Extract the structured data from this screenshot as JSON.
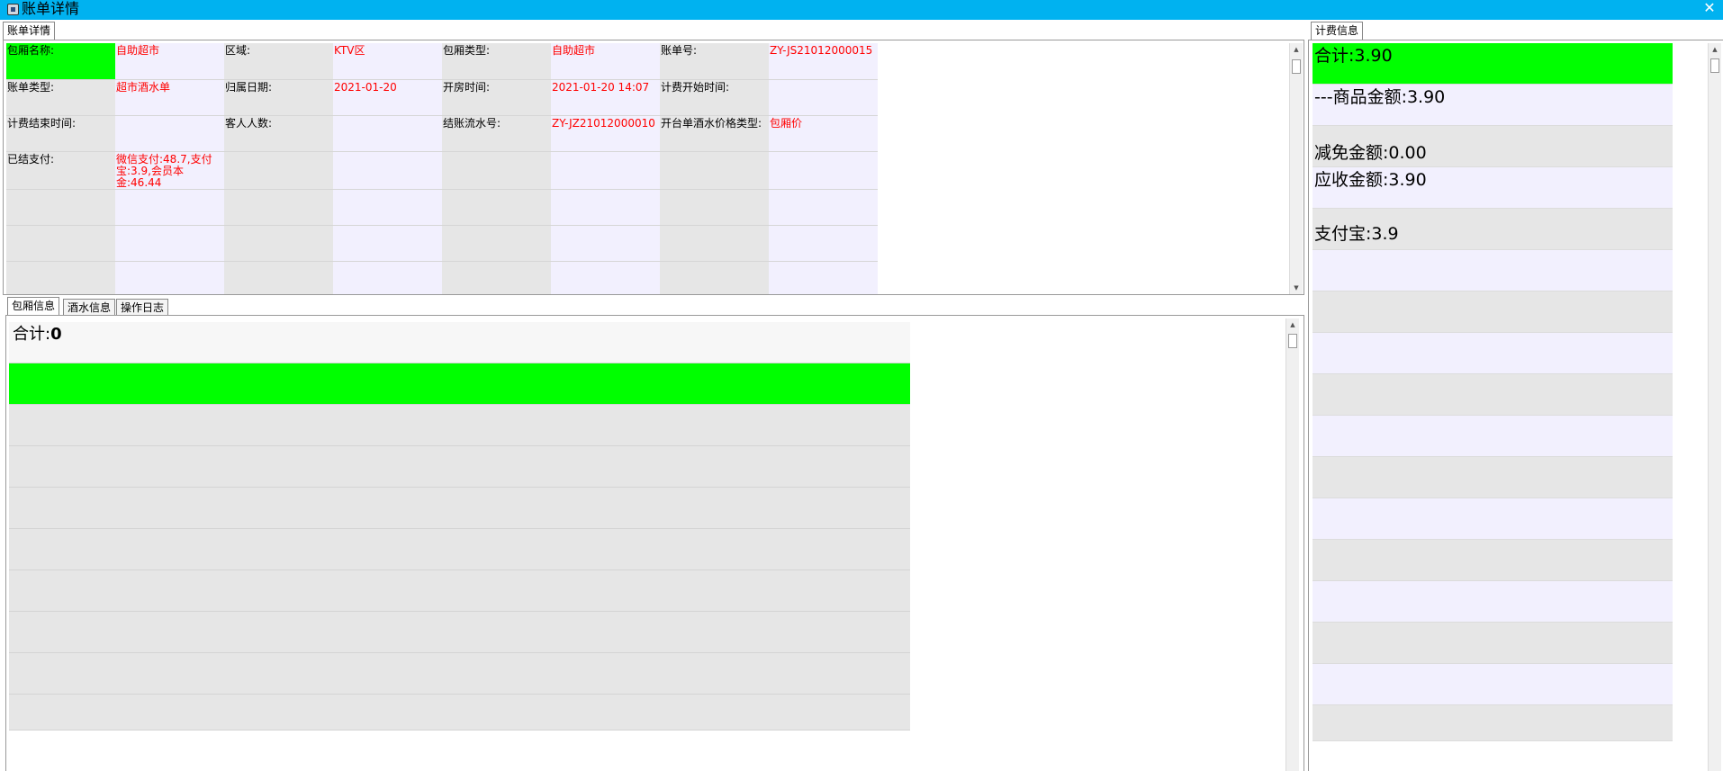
{
  "window": {
    "title": "账单详情",
    "close_glyph": "✕"
  },
  "colors": {
    "titlebar": "#00b2f0",
    "highlight": "#00ff00",
    "value_text": "#ff0000",
    "label_bg": "#e6e6e6",
    "value_bg": "#f2f0fe"
  },
  "detail_tab": {
    "label": "账单详情"
  },
  "bill": {
    "fields": [
      {
        "label": "包厢名称:",
        "value": "自助超市"
      },
      {
        "label": "区域:",
        "value": "KTV区"
      },
      {
        "label": "包厢类型:",
        "value": "自助超市"
      },
      {
        "label": "账单号:",
        "value": "ZY-JS21012000015"
      },
      {
        "label": "账单类型:",
        "value": "超市酒水单"
      },
      {
        "label": "归属日期:",
        "value": "2021-01-20"
      },
      {
        "label": "开房时间:",
        "value": "2021-01-20 14:07"
      },
      {
        "label": "计费开始时间:",
        "value": ""
      },
      {
        "label": "计费结束时间:",
        "value": ""
      },
      {
        "label": "客人人数:",
        "value": ""
      },
      {
        "label": "结账流水号:",
        "value": "ZY-JZ21012000010"
      },
      {
        "label": "开台单酒水价格类型:",
        "value": "包厢价"
      },
      {
        "label": "已结支付:",
        "value": "微信支付:48.7,支付宝:3.9,会员本金:46.44"
      }
    ]
  },
  "bottom_tabs": [
    {
      "label": "包厢信息"
    },
    {
      "label": "酒水信息"
    },
    {
      "label": "操作日志"
    }
  ],
  "room_info": {
    "total_label": "合计:",
    "total_value": "0"
  },
  "billing_tab": {
    "label": "计费信息"
  },
  "billing_info": {
    "rows": [
      "合计:3.90",
      "---商品金额:3.90",
      "减免金额:0.00",
      "应收金额:3.90",
      "支付宝:3.9"
    ]
  },
  "icons": {
    "close": "close-icon",
    "app": "app-icon",
    "scroll_up": "scroll-up-icon",
    "scroll_down": "scroll-down-icon"
  }
}
